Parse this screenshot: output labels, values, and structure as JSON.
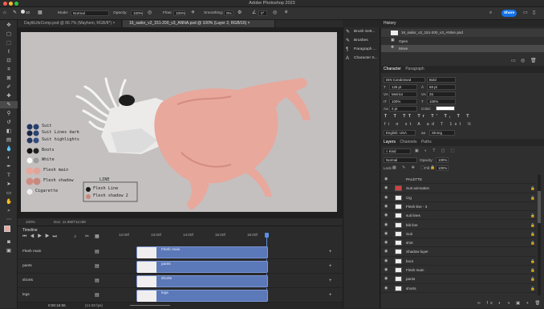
{
  "app": {
    "title": "Adobe Photoshop 2023",
    "share_label": "Share"
  },
  "options_bar": {
    "mode_label": "Mode:",
    "mode_value": "Normal",
    "opacity_label": "Opacity:",
    "opacity_value": "100%",
    "flow_label": "Flow:",
    "flow_value": "100%",
    "smoothing_label": "Smoothing:",
    "smoothing_value": "0%",
    "angle_value": "0°",
    "brush_size": "10"
  },
  "doc_tabs": [
    {
      "label": "DaylitLifeComp.psd @ 66.7% (Mayhem, RGB/8*) ×",
      "active": false
    },
    {
      "label": "16_sailor_v2_151-200_v3_ANNA.psd @ 100% (Layer 2, RGB/16) ×",
      "active": true
    }
  ],
  "status": {
    "zoom": "100%",
    "doc": "Doc: 11.9M/712.0M"
  },
  "palette": {
    "items": [
      "Suit",
      "Suit Lines dark",
      "Suit highlights",
      "Boots",
      "White",
      "Flesh main",
      "Flesh shadow",
      "Cigarette"
    ],
    "box_title": "LINE",
    "box_items": [
      "Flesh Line",
      "Flesh shadow 2"
    ]
  },
  "dock": {
    "items": [
      "Brush Sett...",
      "Brushes",
      "Paragraph ...",
      "Character S..."
    ]
  },
  "history": {
    "title": "History",
    "doc": "16_sailor_v2_151-200_v3_ANNA.psd",
    "steps": [
      "Open",
      "Move"
    ]
  },
  "character": {
    "tabs": [
      "Character",
      "Paragraph"
    ],
    "font": "DIN Condensed",
    "style": "Bold",
    "size": "125 pt",
    "leading": "68 pt",
    "kerning": "Metrics",
    "tracking": "26",
    "vscale": "100%",
    "hscale": "100%",
    "baseline": "0 pt",
    "color_label": "Color:",
    "glyphs": [
      "T",
      "T",
      "TT",
      "Tr",
      "T'",
      "T,",
      "T",
      "T"
    ],
    "extras": [
      "fi",
      "σ",
      "st",
      "A",
      "ad",
      "T",
      "1st",
      "½"
    ],
    "language": "English: USA",
    "aa_label": "aa",
    "aa_value": "Strong"
  },
  "layers_panel": {
    "tabs": [
      "Layers",
      "Channels",
      "Paths"
    ],
    "kind": "Kind",
    "blend": "Normal",
    "opacity_label": "Opacity:",
    "opacity_value": "100%",
    "lock_label": "Lock:",
    "fill_label": "Fill:",
    "fill_value": "100%",
    "layers": [
      {
        "name": "PALETTE",
        "lock": false
      },
      {
        "name": "Suit animation",
        "lock": true
      },
      {
        "name": "Cig",
        "lock": true
      },
      {
        "name": "Flesh line - 3",
        "lock": false
      },
      {
        "name": "suit lines",
        "lock": true
      },
      {
        "name": "bib line",
        "lock": true
      },
      {
        "name": "Suit",
        "lock": true
      },
      {
        "name": "shirt",
        "lock": true
      },
      {
        "name": "Shadow layer",
        "lock": false
      },
      {
        "name": "boot",
        "lock": true
      },
      {
        "name": "Flesh main",
        "lock": true
      },
      {
        "name": "pants",
        "lock": true
      },
      {
        "name": "shorts",
        "lock": true
      }
    ]
  },
  "timeline": {
    "title": "Timeline",
    "ruler": [
      "12:00f",
      "13:00f",
      "14:00f",
      "15:00f",
      "16:00f"
    ],
    "tracks": [
      {
        "name": "Flesh main",
        "clip": "Flesh main"
      },
      {
        "name": "pants",
        "clip": "pants"
      },
      {
        "name": "shorts",
        "clip": "shorts"
      },
      {
        "name": "legs",
        "clip": "legs"
      }
    ],
    "timecode": "0:00:16:06",
    "fps": "(12.00 fps)"
  },
  "colors": {
    "accent": "#1473e6",
    "canvas": "#c4c0c0",
    "clip": "#5b78b8",
    "flesh": "#e8a89c"
  }
}
